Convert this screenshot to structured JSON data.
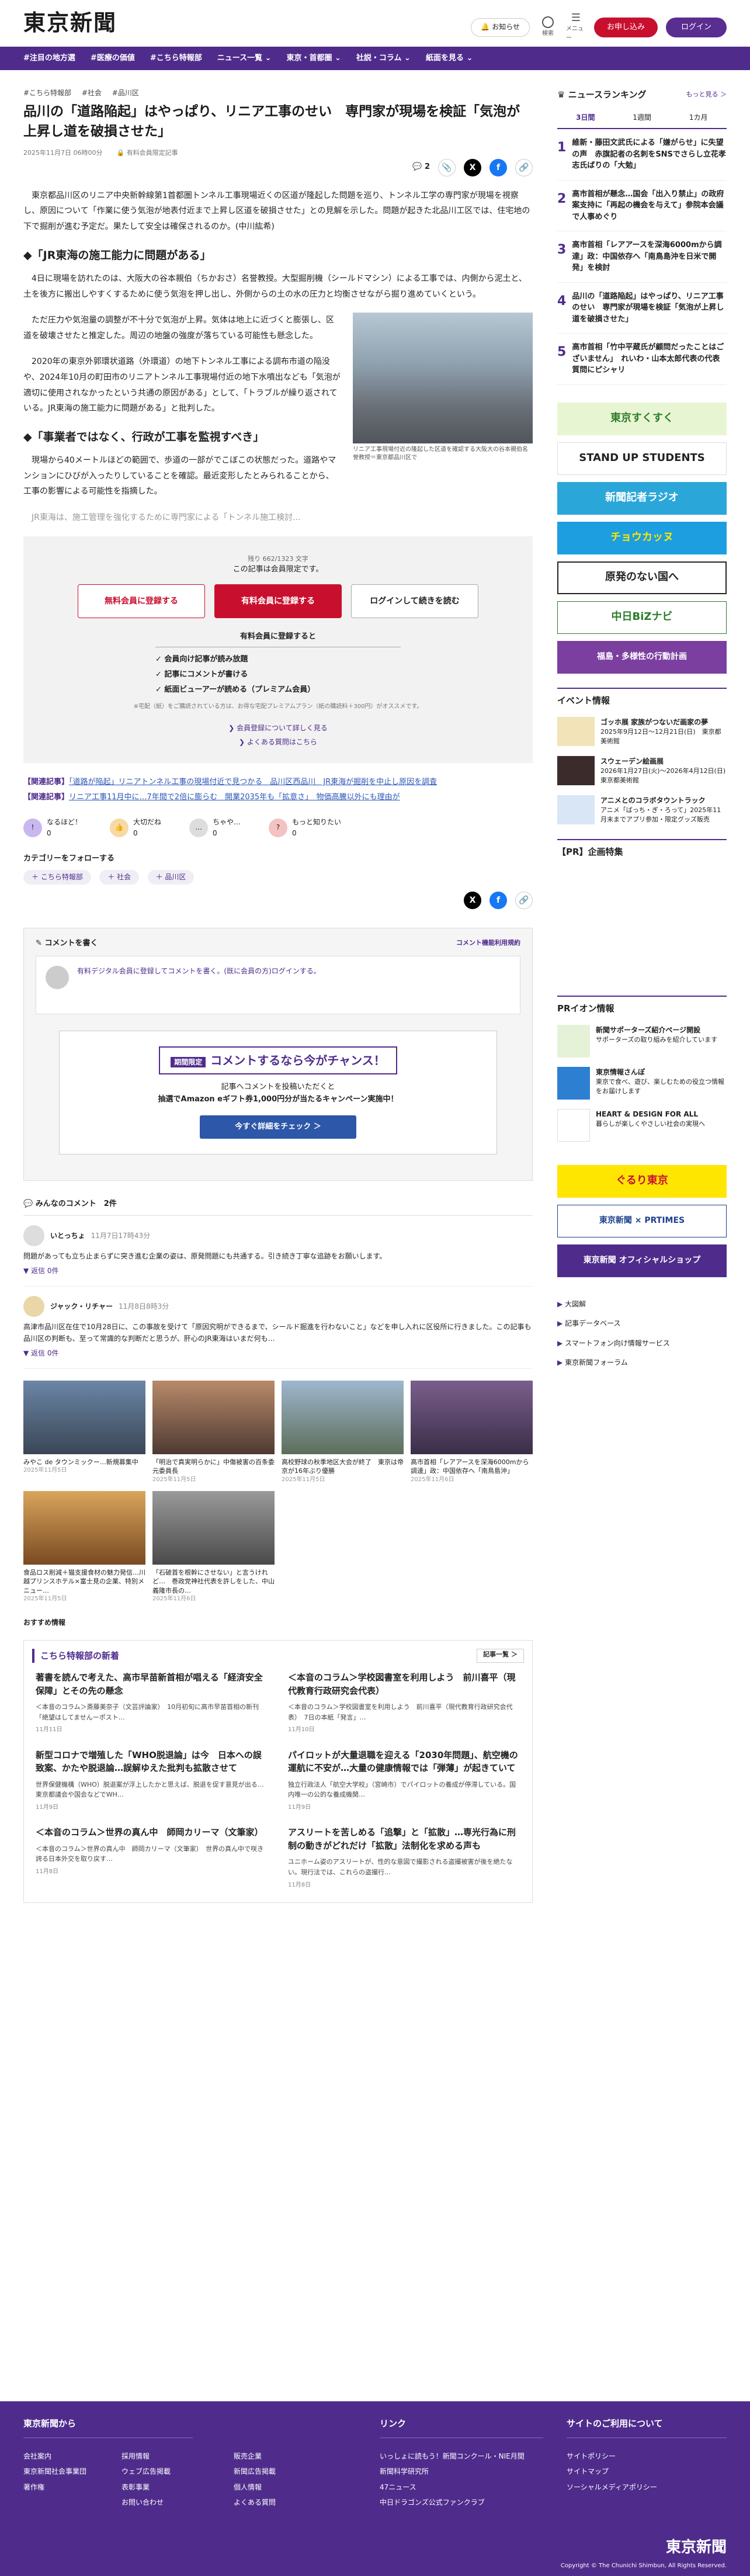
{
  "header": {
    "logo": "東京新聞",
    "notify": "お知らせ",
    "search": "検索",
    "menu": "メニュー",
    "register": "お申し込み",
    "login": "ログイン"
  },
  "nav": [
    "#注目の地方選",
    "#医療の価値",
    "#こちら特報部",
    "ニュース一覧 ⌄",
    "東京・首都圏 ⌄",
    "社説・コラム ⌄",
    "紙面を見る ⌄"
  ],
  "article": {
    "crumbs": [
      "#こちら特報部",
      "#社会",
      "#品川区"
    ],
    "title": "品川の「道路陥起」はやっぱり、リニア工事のせい　専門家が現場を検証「気泡が上昇し道を破損させた」",
    "date": "2025年11月7日 06時00分",
    "badge": "有料会員限定記事",
    "comments": "2",
    "lead": "東京都品川区のリニア中央新幹線第1首都圏トンネル工事現場近くの区道が隆起した問題を巡り、トンネル工学の専門家が現場を視察し、原因について「作業に使う気泡が地表付近まで上昇し区道を破損させた」との見解を示した。問題が起きた北品川工区では、住宅地の下で掘削が進む予定だ。果たして安全は確保されるのか。(中川紘希)",
    "h2a": "「JR東海の施工能力に問題がある」",
    "p1": "4日に現場を訪れたのは、大阪大の谷本親伯（ちかおさ）名誉教授。大型掘削機（シールドマシン）による工事では、内側から泥土と、土を後方に搬出しやすくするために使う気泡を押し出し、外側からの土の水の圧力と均衡させながら掘り進めていくという。",
    "p2": "ただ圧力や気泡量の調整が不十分で気泡が上昇。気体は地上に近づくと膨張し、区道を破壊させたと推定した。周辺の地盤の強度が落ちている可能性も懸念した。",
    "p3": "2020年の東京外郭環状道路（外環道）の地下トンネル工事による調布市道の陥没や、2024年10月の町田市のリニアトンネル工事現場付近の地下水噴出なども「気泡が適切に使用されなかったという共通の原因がある」として、「トラブルが繰り返されている。JR東海の施工能力に問題がある」と批判した。",
    "h2b": "「事業者ではなく、行政が工事を監視すべき」",
    "p4": "現場から40メートルほどの範囲で、歩道の一部がでこぼこの状態だった。道路やマンションにひびが入ったりしていることを確認。最近変形したとみられることから、工事の影響による可能性を指摘した。",
    "p5": "JR東海は、施工管理を強化するために専門家による「トンネル施工検討...",
    "caption": "リニア工事現場付近の隆起した区道を確認する大阪大の谷本親伯名誉教授＝東京都品川区で"
  },
  "paywall": {
    "count": "残り 662/1323 文字",
    "note": "この記事は会員限定です。",
    "b1": "無料会員に登録する",
    "b2": "有料会員に登録する",
    "b3": "ログインして続きを読む",
    "bhead": "有料会員に登録すると",
    "benefits": [
      "✓ 会員向け記事が読み放題",
      "✓ 記事にコメントが書ける",
      "✓ 紙面ビューアーが読める（プレミアム会員）"
    ],
    "small": "※宅配（紙）をご購読されている方は、お得な宅配プレミアムプラン（紙の購読料＋300円）がオススメです。",
    "l1": "会員登録について詳しく見る",
    "l2": "よくある質問はこちら"
  },
  "related": {
    "label": "【関連記事】",
    "r1": "「道路が陥起」リニアトンネル工事の現場付近で見つかる　品川区西品川　JR東海が掘削を中止し原因を調査",
    "r2": "リニア工事11月中に…7年間で2倍に膨らむ　開業2035年も「拡意さ」　物価高騰以外にも理由が"
  },
  "reactions": [
    "なるほど！",
    "大切だね",
    "ちゃや…",
    "もっと知りたい"
  ],
  "reaction_counts": [
    "0",
    "0",
    "0",
    "0"
  ],
  "follow": {
    "label": "カテゴリーをフォローする",
    "tags": [
      "こちら特報部",
      "社会",
      "品川区"
    ]
  },
  "comment_form": {
    "label": "コメントを書く",
    "rule": "コメント機能利用規約",
    "prompt": "有料デジタル会員に登録してコメントを書く。(既に会員の方)ログインする。"
  },
  "campaign": {
    "badge": "期間限定",
    "title": "コメントするなら今がチャンス！",
    "d1": "記事へコメントを投稿いただくと",
    "d2": "抽選でAmazon eギフト券1,000円分が当たるキャンペーン実施中！",
    "btn": "今すぐ詳細をチェック ＞"
  },
  "comments_section": {
    "title": "みんなのコメント",
    "count": "2件",
    "items": [
      {
        "user": "いとっちょ",
        "date": "11月7日17時43分",
        "text": "問題があっても立ち止まらずに突き進む企業の姿は、原発問題にも共通する。引き続き丁寧な追跡をお願いします。",
        "reply": "返信 0件"
      },
      {
        "user": "ジャック・リチャー",
        "date": "11月8日8時3分",
        "text": "高津市品川区在住で10月28日に、この事故を受けて「原因究明ができるまで、シールド掘進を行わないこと」などを申し入れに区役所に行きました。この記事も品川区の判断も、至って常識的な判断だと思うが、肝心のJR東海はいまだ何も…",
        "reply": "返信 0件"
      }
    ]
  },
  "more_thumbs": [
    {
      "title": "みやこ de タウンミックー…新規募集中",
      "date": "2025年11月5日"
    },
    {
      "title": "「明治で真実明らかに」中傷被害の百条委元委員長",
      "date": "2025年11月5日"
    },
    {
      "title": "高校野球の秋季地区大会が終了　東京は帝京が16年ぶり優勝",
      "date": "2025年11月5日"
    },
    {
      "title": "高市首相「レアアースを深海6000mから調達」政：中国依存へ「南鳥島沖」",
      "date": "2025年11月6日"
    },
    {
      "title": "食品ロス削減＋猫支援食材の魅力発信…川越プリンスホテル×富士見の企業、特別メニュー…",
      "date": "2025年11月5日"
    },
    {
      "title": "「石破首を根幹にさせない」と言うけれど…　巻政党神社代表を許しをした、中山義隆市長の…",
      "date": "2025年11月6日"
    }
  ],
  "recommend": "おすすめ情報",
  "kochira": {
    "title": "こちら特報部の新着",
    "more": "記事一覧 ＞",
    "items": [
      {
        "title": "著書を読んで考えた、高市早苗新首相が唱える「経済安全保障」とその先の懸念",
        "text": "＜本音のコラム＞斎藤美奈子（文芸評論家）　10月初旬に高市早苗首相の新刊「絶望はしてませんーポスト…",
        "date": "11月11日"
      },
      {
        "title": "＜本音のコラム＞学校図書室を利用しよう　前川喜平（現代教育行政研究会代表）",
        "text": "＜本音のコラム＞学校図書室を利用しよう　前川喜平（現代教育行政研究会代表）　7日の本紙「発言」…",
        "date": "11月10日"
      },
      {
        "title": "新型コロナで増殖した「WHO脱退論」は今　日本への誤致案、かたや脱退論…誤解ゆえた批判も拡散させて",
        "text": "世界保健機構（WHO）脱退案が浮上したかと思えば、脱退を促す意見が出る…東京都議会や国会などでWH…",
        "date": "11月9日"
      },
      {
        "title": "パイロットが大量退職を迎える「2030年問題」、航空機の運航に不安が…大量の健康情報では「弾薄」が起きていて",
        "text": "独立行政法人「航空大学校」（宮崎市）でパイロットの養成が停滞している。国内唯一の公的な養成機関…",
        "date": "11月9日"
      },
      {
        "title": "＜本音のコラム＞世界の真ん中　師岡カリーマ（文筆家）",
        "text": "＜本音のコラム＞世界の真ん中　師岡カリーマ（文筆家）　世界の真ん中で咲き誇る日本外交を取り戻す…",
        "date": "11月8日"
      },
      {
        "title": "アスリートを苦しめる「追撃」と「拡散」…専光行為に刑制の動きがどれだけ「拡散」法制化を求める声も",
        "text": "ユニホーム姿のアスリートが、性的な意図で撮影される盗撮被害が後を絶たない。現行法では、これらの盗撮行…",
        "date": "11月8日"
      }
    ]
  },
  "sidebar": {
    "rank_title": "ニュースランキング",
    "rank_more": "もっと見る ＞",
    "tabs": [
      "3日間",
      "1週間",
      "1カ月"
    ],
    "rank": [
      {
        "n": "1",
        "t": "維新・藤田文武氏による「嫌がらせ」に失望の声　赤旗記者の名刺をSNSでさらし立花孝志氏ばりの「大勉」"
      },
      {
        "n": "2",
        "t": "高市首相が懸念…国会「出入り禁止」の政府案支持に「再起の機会を与えて」参院本会議で人事めぐり"
      },
      {
        "n": "3",
        "t": "高市首相「レアアースを深海6000mから調達」政：中国依存へ「南鳥島沖を日米で開発」を検討"
      },
      {
        "n": "4",
        "t": "品川の「道路陥起」はやっぱり、リニア工事のせい　専門家が現場を検証「気泡が上昇し道を破損させた」"
      },
      {
        "n": "5",
        "t": "高市首相「竹中平蔵氏が顧問だったことはございません」　れいわ・山本太郎代表の代表質問にピシャリ"
      }
    ],
    "banners": [
      "東京すくすく",
      "STAND UP STUDENTS",
      "新聞記者ラジオ",
      "チョウカッヌ",
      "原発のない国へ",
      "中日BiZナビ",
      "福島・多様性の行動計画"
    ],
    "event_title": "イベント情報",
    "events": [
      {
        "t": "ゴッホ展 家族がつないだ画家の夢",
        "d": "2025年9月12日〜12月21日(日)　東京都美術館"
      },
      {
        "t": "スウェーデン絵画展",
        "d": "2026年1月27日(火)〜2026年4月12日(日)　東京都美術館"
      },
      {
        "t": "アニメとのコラボタウントラック",
        "d": "アニメ「ばっち・ぎ・ろって」2025年11月末までアプリ参加・限定グッズ販売"
      }
    ],
    "pr_title": "【PR】企画特集",
    "ira_title": "PRイオン情報",
    "ira": [
      {
        "t": "新聞サポーターズ紹介ページ開設",
        "d": "サポーターズの取り組みを紹介しています"
      },
      {
        "t": "東京情報さんぽ",
        "d": "東京で食べ、遊び、楽しむための役立つ情報をお届けします"
      },
      {
        "t": "HEART & DESIGN FOR ALL",
        "d": "暮らしが楽しくやさしい社会の実現へ"
      }
    ],
    "banners2": [
      "ぐるり東京",
      "東京新聞 × PRTIMES",
      "東京新聞 オフィシャルショップ"
    ],
    "links": [
      "大図解",
      "記事データベース",
      "スマートフォン向け情報サービス",
      "東京新聞フォーラム"
    ]
  },
  "footer": {
    "c1": "東京新聞から",
    "c1items": [
      "会社案内",
      "採用情報",
      "東京新聞社会事業団",
      "著作権",
      "ウェブ広告掲載",
      "表彰事業",
      "お問い合わせ"
    ],
    "c1b": [
      "販売企業",
      "新聞広告掲載",
      "個人情報",
      "よくある質問"
    ],
    "c2": "リンク",
    "c2items": [
      "いっしょに読もう！新聞コンクール・NIE月間",
      "新聞科学研究所",
      "47ニュース",
      "中日ドラゴンズ公式ファンクラブ"
    ],
    "c3": "サイトのご利用について",
    "c3items": [
      "サイトポリシー",
      "サイトマップ",
      "ソーシャルメディアポリシー"
    ],
    "logo": "東京新聞",
    "copy": "Copyright © The Chunichi Shimbun, All Rights Reserved."
  }
}
